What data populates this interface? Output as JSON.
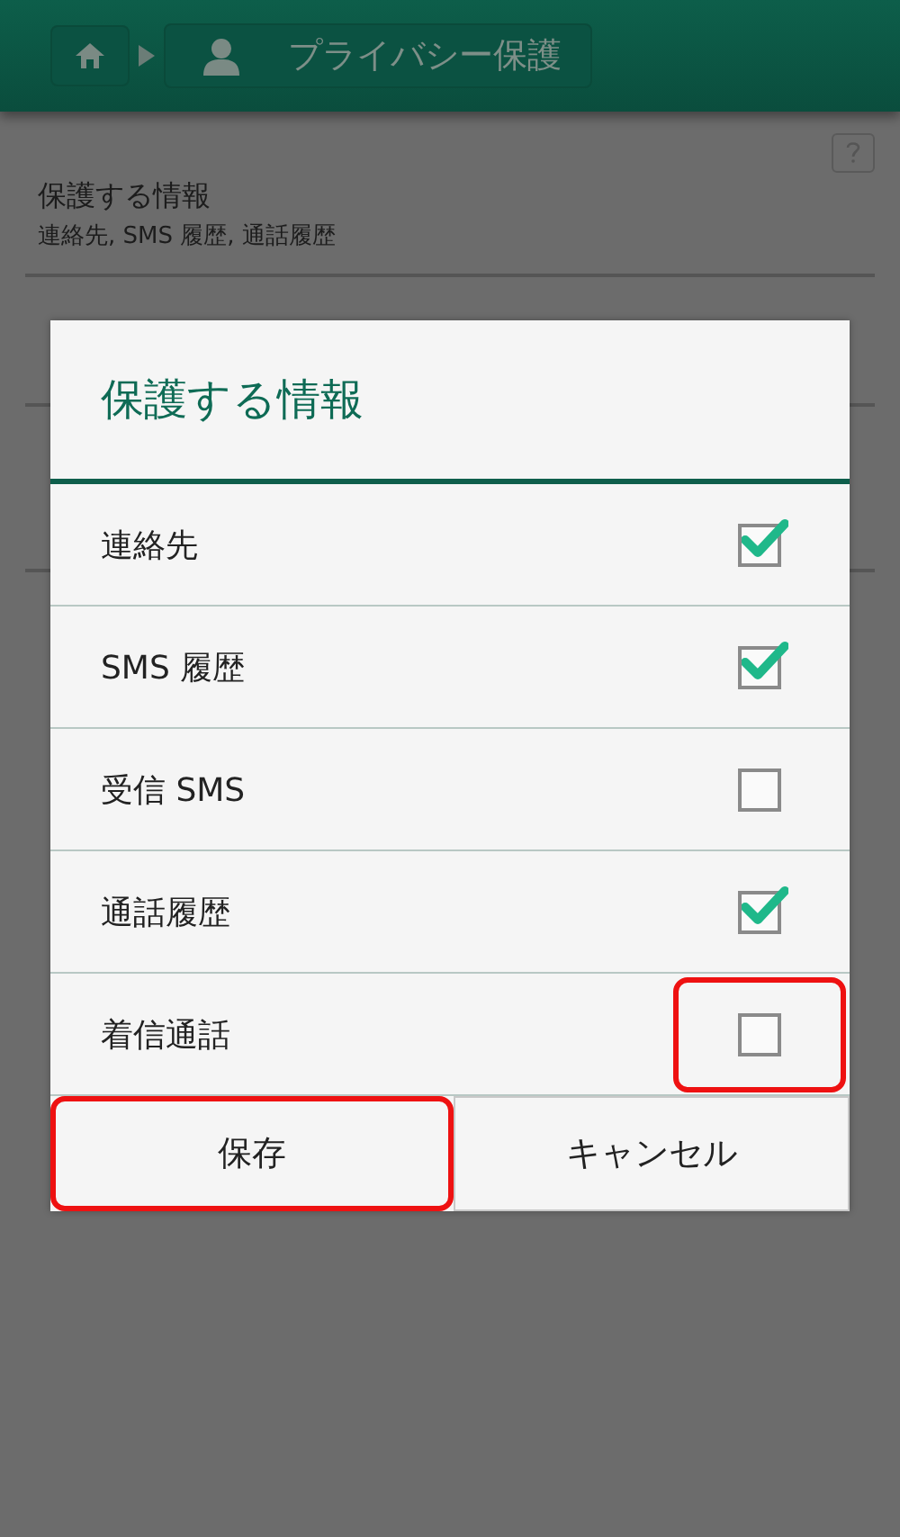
{
  "header": {
    "title": "プライバシー保護"
  },
  "settings": [
    {
      "title": "保護する情報",
      "lines": [
        "連絡先, SMS 履歴, 通話履歴"
      ]
    }
  ],
  "dialog": {
    "title": "保護する情報",
    "options": [
      {
        "label": "連絡先",
        "checked": true,
        "highlighted": false
      },
      {
        "label": "SMS 履歴",
        "checked": true,
        "highlighted": false
      },
      {
        "label": "受信 SMS",
        "checked": false,
        "highlighted": false
      },
      {
        "label": "通話履歴",
        "checked": true,
        "highlighted": false
      },
      {
        "label": "着信通話",
        "checked": false,
        "highlighted": true
      }
    ],
    "buttons": [
      {
        "label": "保存",
        "highlighted": true
      },
      {
        "label": "キャンセル",
        "highlighted": false
      }
    ]
  }
}
